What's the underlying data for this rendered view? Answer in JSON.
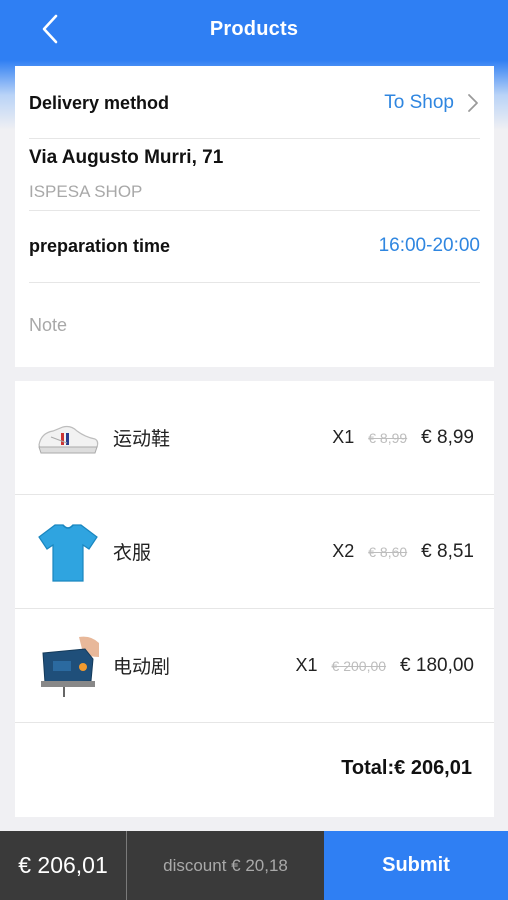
{
  "header": {
    "title": "Products",
    "back_icon": "chevron-left-icon"
  },
  "delivery": {
    "label": "Delivery method",
    "value": "To Shop",
    "address": "Via Augusto Murri, 71",
    "shop": "ISPESA SHOP",
    "prep_label": "preparation time",
    "prep_value": "16:00-20:00",
    "note_placeholder": "Note"
  },
  "products": [
    {
      "name": "运动鞋",
      "qty": "X1",
      "old_price": "€ 8,99",
      "price": "€ 8,99",
      "icon": "sneaker-image"
    },
    {
      "name": "衣服",
      "qty": "X2",
      "old_price": "€ 8,60",
      "price": "€ 8,51",
      "icon": "tshirt-image"
    },
    {
      "name": "电动剧",
      "qty": "X1",
      "old_price": "€ 200,00",
      "price": "€ 180,00",
      "icon": "jigsaw-image"
    }
  ],
  "total": "Total:€ 206,01",
  "footer": {
    "total": "€ 206,01",
    "discount": "discount € 20,18",
    "submit": "Submit"
  },
  "colors": {
    "accent": "#2f7ff3",
    "link": "#2f86e0",
    "footer_dark": "#3a3a3a"
  }
}
